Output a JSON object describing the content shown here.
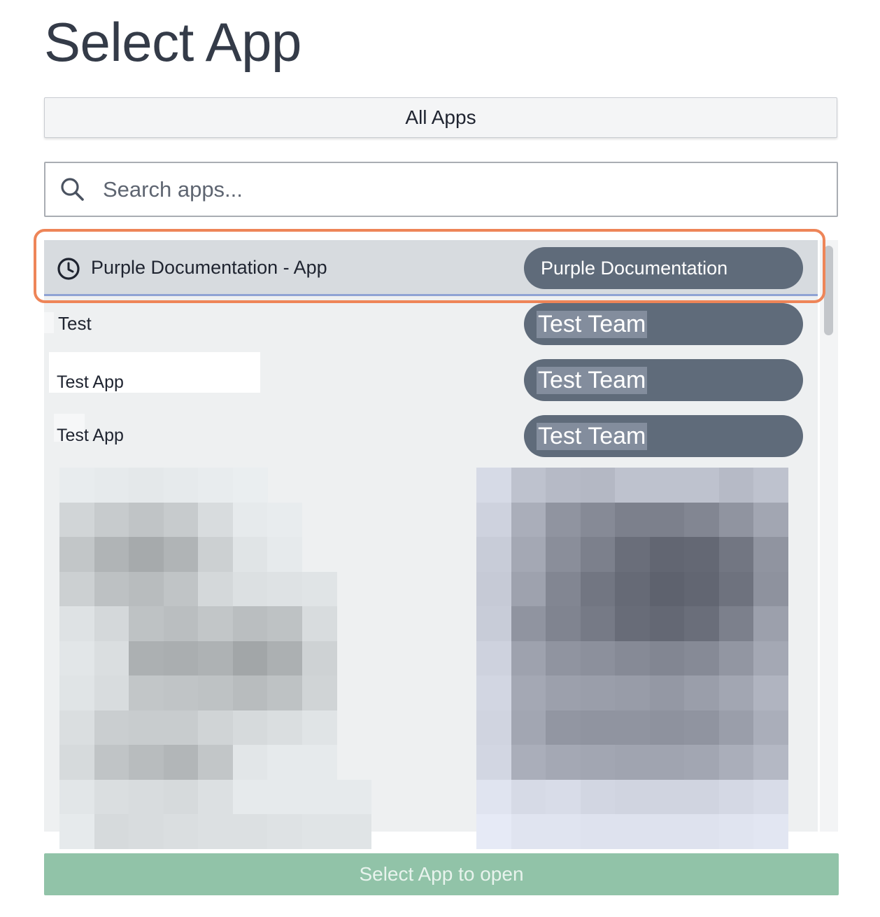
{
  "page": {
    "title": "Select App"
  },
  "filter": {
    "label": "All Apps"
  },
  "search": {
    "placeholder": "Search apps..."
  },
  "apps": [
    {
      "name": "Purple Documentation - App",
      "team": "Purple Documentation",
      "recent": true,
      "selected": true
    },
    {
      "name": "Test",
      "team": "Test Team"
    },
    {
      "name": "Test App",
      "team": "Test Team"
    },
    {
      "name": "Test App",
      "team": "Test Team"
    }
  ],
  "footer": {
    "open_label": "Select App to open"
  },
  "colors": {
    "pill": "#5f6b7a",
    "highlight_ring": "#ee8558",
    "open_button": "#91c3a8",
    "selected_row": "#d7dbdf"
  },
  "icons": {
    "search": "search-icon",
    "recent": "clock-icon"
  }
}
